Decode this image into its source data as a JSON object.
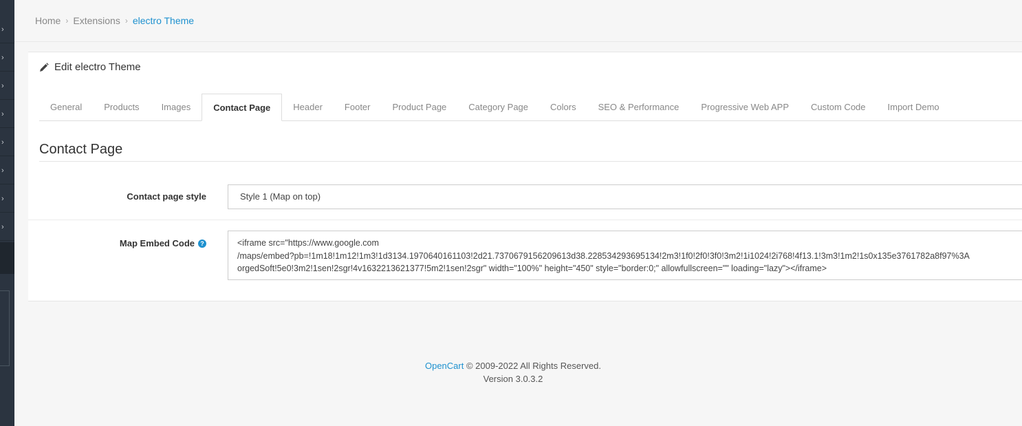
{
  "breadcrumb": {
    "items": [
      "Home",
      "Extensions",
      "electro Theme"
    ],
    "separator": "›"
  },
  "panel": {
    "title": "Edit electro Theme",
    "icon": "pencil-icon"
  },
  "tabs": [
    {
      "label": "General"
    },
    {
      "label": "Products"
    },
    {
      "label": "Images"
    },
    {
      "label": "Contact Page",
      "active": true
    },
    {
      "label": "Header"
    },
    {
      "label": "Footer"
    },
    {
      "label": "Product Page"
    },
    {
      "label": "Category Page"
    },
    {
      "label": "Colors"
    },
    {
      "label": "SEO & Performance"
    },
    {
      "label": "Progressive Web APP"
    },
    {
      "label": "Custom Code"
    },
    {
      "label": "Import Demo"
    }
  ],
  "section": {
    "title": "Contact Page"
  },
  "form": {
    "contact_style": {
      "label": "Contact page style",
      "value": "Style 1 (Map on top)"
    },
    "map_embed": {
      "label": "Map Embed Code",
      "help": "?",
      "value": "<iframe src=\"https://www.google.com\n/maps/embed?pb=!1m18!1m12!1m3!1d3134.1970640161103!2d21.7370679156209613d38.228534293695134!2m3!1f0!2f0!3f0!3m2!1i1024!2i768!4f13.1!3m3!1m2!1s0x135e3761782a8f97%3A\norgedSoft!5e0!3m2!1sen!2sgr!4v1632213621377!5m2!1sen!2sgr\" width=\"100%\" height=\"450\" style=\"border:0;\" allowfullscreen=\"\" loading=\"lazy\"></iframe>"
    }
  },
  "footer": {
    "brand": "OpenCart",
    "copyright": " © 2009-2022 All Rights Reserved.",
    "version": "Version 3.0.3.2"
  },
  "colors": {
    "accent": "#1e91cf",
    "sidebar": "#2b3440"
  }
}
